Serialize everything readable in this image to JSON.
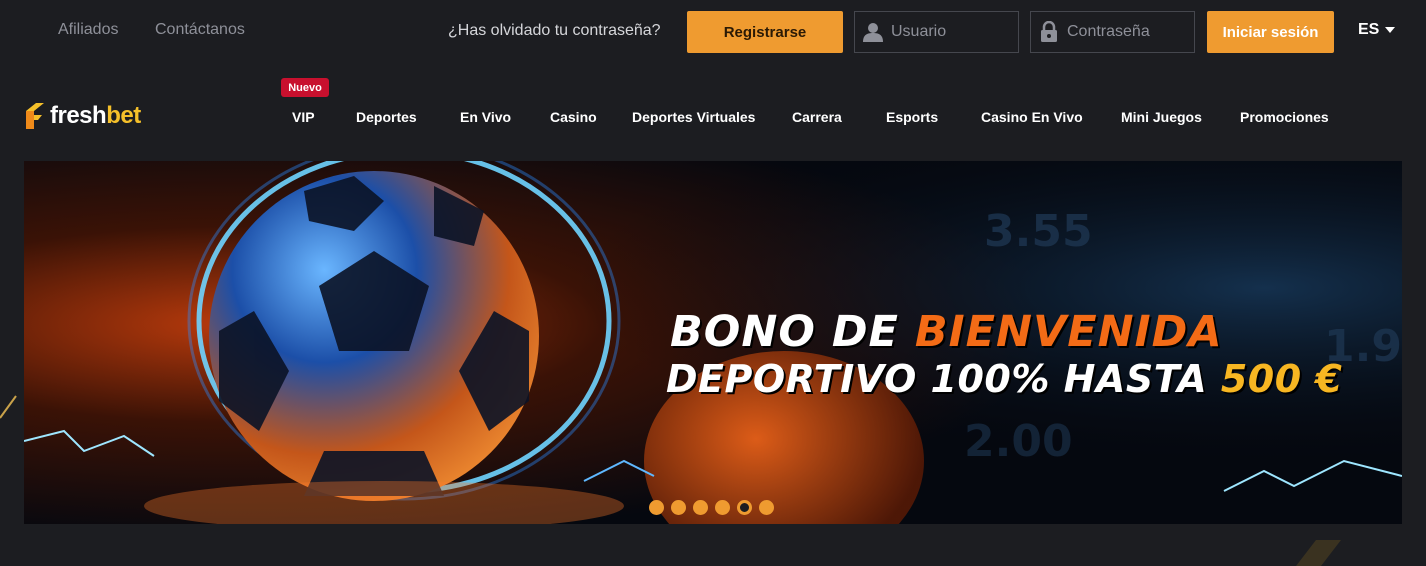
{
  "topbar": {
    "links": [
      "Afiliados",
      "Contáctanos"
    ],
    "forgot": "¿Has olvidado tu contraseña?",
    "register": "Registrarse",
    "username_placeholder": "Usuario",
    "password_placeholder": "Contraseña",
    "login": "Iniciar sesión",
    "language": "ES"
  },
  "brand": {
    "part1": "fresh",
    "part2": "bet"
  },
  "nav": {
    "badge": "Nuevo",
    "items": [
      "VIP",
      "Deportes",
      "En Vivo",
      "Casino",
      "Deportes Virtuales",
      "Carrera",
      "Esports",
      "Casino En Vivo",
      "Mini Juegos",
      "Promociones"
    ]
  },
  "banner": {
    "line1_white": "BONO DE ",
    "line1_orange": "BIENVENIDA",
    "line2_white": "DEPORTIVO 100% HASTA ",
    "line2_yellow": "500 €",
    "background_numbers": [
      "3.55",
      "1.9",
      "2.00"
    ],
    "slide_count": 6,
    "active_slide": 5
  },
  "colors": {
    "accent": "#ef9b30",
    "badge": "#c8102e",
    "background": "#1c1d21",
    "brand_yellow": "#f5c02a"
  }
}
